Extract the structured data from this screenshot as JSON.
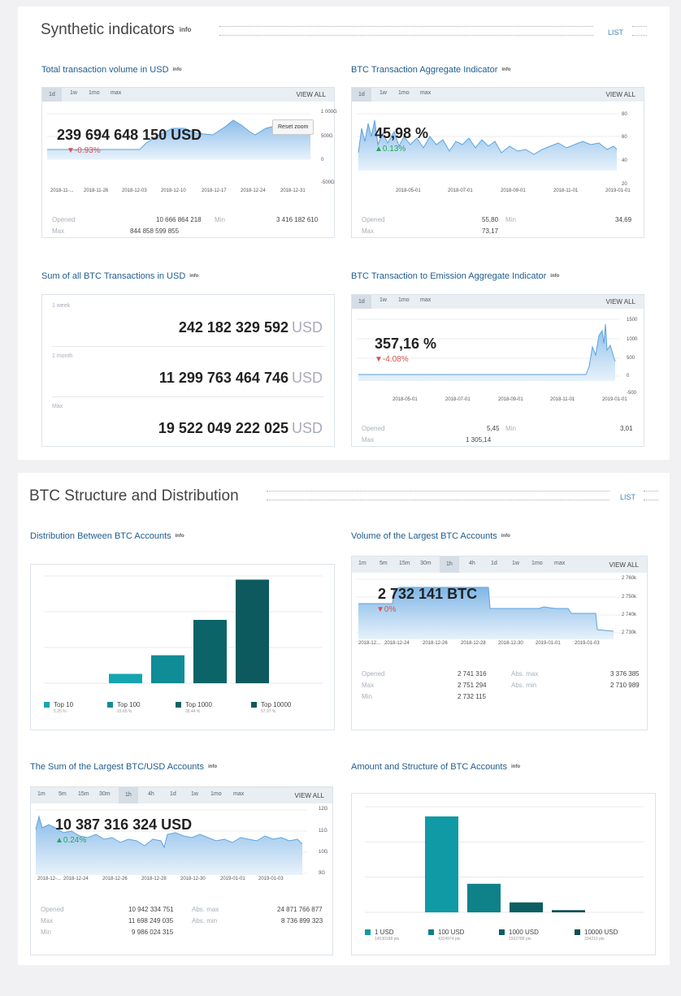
{
  "sec1": {
    "title": "Synthetic indicators",
    "info": "info",
    "list": "LIST",
    "tx_volume": {
      "title": "Total transaction volume in USD",
      "info": "info",
      "tabs": [
        "1d",
        "1w",
        "1mo",
        "max"
      ],
      "view_all": "VIEW ALL",
      "value": "239 694 648 150 USD",
      "change": "▼-0.93%",
      "reset_zoom": "Reset zoom",
      "x_ticks": [
        "2018-11-...",
        "2018-11-26",
        "2018-12-03",
        "2018-12-10",
        "2018-12-17",
        "2018-12-24",
        "2018-12-31"
      ],
      "y_ticks": [
        "1 000G",
        "500G",
        "0",
        "-500G"
      ],
      "opened_label": "Opened",
      "opened": "10 666 864 218",
      "min_label": "Min",
      "min": "3 416 182 610",
      "max_label": "Max",
      "max": "844 858 599 855"
    },
    "aggregate": {
      "title": "BTC Transaction Aggregate Indicator",
      "info": "info",
      "tabs": [
        "1d",
        "1w",
        "1mo",
        "max"
      ],
      "view_all": "VIEW ALL",
      "value": "45,98 %",
      "change": "▲0.13%",
      "x_ticks": [
        "2018-05-01",
        "2018-07-01",
        "2018-09-01",
        "2018-11-01",
        "2019-01-01"
      ],
      "y_ticks": [
        "80",
        "60",
        "40",
        "20"
      ],
      "opened_label": "Opened",
      "opened": "55,80",
      "min_label": "Min",
      "min": "34,69",
      "max_label": "Max",
      "max": "73,17"
    },
    "sum_all": {
      "title": "Sum of all BTC Transactions in USD",
      "info": "info",
      "rows": [
        {
          "label": "1 week",
          "value": "242 182 329 592",
          "unit": "USD"
        },
        {
          "label": "1 month",
          "value": "11 299 763 464 746",
          "unit": "USD"
        },
        {
          "label": "Max",
          "value": "19 522 049 222 025",
          "unit": "USD"
        }
      ]
    },
    "emission": {
      "title": "BTC Transaction to Emission Aggregate Indicator",
      "info": "info",
      "tabs": [
        "1d",
        "1w",
        "1mo",
        "max"
      ],
      "view_all": "VIEW ALL",
      "value": "357,16 %",
      "change": "▼-4.08%",
      "x_ticks": [
        "2018-05-01",
        "2018-07-01",
        "2018-09-01",
        "2018-11-01",
        "2019-01-01"
      ],
      "y_ticks": [
        "1500",
        "1000",
        "500",
        "0",
        "-500"
      ],
      "opened_label": "Opened",
      "opened": "5,45",
      "min_label": "Min",
      "min": "3,01",
      "max_label": "Max",
      "max": "1 305,14"
    }
  },
  "sec2": {
    "title": "BTC Structure and Distribution",
    "list": "LIST",
    "distribution": {
      "title": "Distribution Between BTC Accounts",
      "info": "info",
      "legend": [
        {
          "name": "Top 10",
          "sub": "5.25 %",
          "color": "#16a5b0"
        },
        {
          "name": "Top 100",
          "sub": "15.65 %",
          "color": "#0f8c96"
        },
        {
          "name": "Top 1000",
          "sub": "35.44 %",
          "color": "#0b6468"
        },
        {
          "name": "Top 10000",
          "sub": "57.97 %",
          "color": "#0d5a5e"
        }
      ]
    },
    "largest": {
      "title": "Volume of the Largest BTC Accounts",
      "info": "info",
      "tabs": [
        "1m",
        "5m",
        "15m",
        "30m",
        "1h",
        "4h",
        "1d",
        "1w",
        "1mo",
        "max"
      ],
      "active_tab": 4,
      "view_all": "VIEW ALL",
      "value": "2 732 141 BTC",
      "change": "▼0%",
      "x_ticks": [
        "2018-12...",
        "2018-12-24",
        "2018-12-26",
        "2018-12-28",
        "2018-12-30",
        "2019-01-01",
        "2019-01-03"
      ],
      "y_ticks": [
        "2 760k",
        "2 750k",
        "2 740k",
        "2 730k"
      ],
      "opened_label": "Opened",
      "opened": "2 741 316",
      "absmax_label": "Abs. max",
      "absmax": "3 376 385",
      "max_label": "Max",
      "max": "2 751 294",
      "absmin_label": "Abs. min",
      "absmin": "2 710 989",
      "min_label": "Min",
      "min": "2 732 115"
    },
    "sum_largest": {
      "title": "The Sum of the Largest BTC/USD Accounts",
      "info": "info",
      "tabs": [
        "1m",
        "5m",
        "15m",
        "30m",
        "1h",
        "4h",
        "1d",
        "1w",
        "1mo",
        "max"
      ],
      "active_tab": 4,
      "view_all": "VIEW ALL",
      "value": "10 387 316 324 USD",
      "change": "▲0.24%",
      "x_ticks": [
        "2018-12-...",
        "2018-12-24",
        "2018-12-26",
        "2018-12-28",
        "2018-12-30",
        "2019-01-01",
        "2019-01-03"
      ],
      "y_ticks": [
        "12G",
        "11G",
        "10G",
        "9G"
      ],
      "opened_label": "Opened",
      "opened": "10 942 334 751",
      "absmax_label": "Abs. max",
      "absmax": "24 871 766 877",
      "max_label": "Max",
      "max": "11 698 249 035",
      "absmin_label": "Abs. min",
      "absmin": "8 736 899 323",
      "min_label": "Min",
      "min": "9 986 024 315"
    },
    "amount": {
      "title": "Amount and Structure of BTC Accounts",
      "info": "info",
      "legend": [
        {
          "name": "1 USD",
          "sub": "14530188 pts",
          "color": "#0f9aa5"
        },
        {
          "name": "100 USD",
          "sub": "4324974 pts",
          "color": "#0f8189"
        },
        {
          "name": "1000 USD",
          "sub": "1502788 pts",
          "color": "#0b5f63"
        },
        {
          "name": "10000 USD",
          "sub": "334210 pts",
          "color": "#0d4f54"
        }
      ]
    }
  },
  "chart_data": [
    {
      "type": "bar",
      "categories": [
        "Top 10",
        "Top 100",
        "Top 1000",
        "Top 10000"
      ],
      "values": [
        5.25,
        15.65,
        35.44,
        57.97
      ],
      "ylim": [
        0,
        60
      ]
    },
    {
      "type": "bar",
      "categories": [
        "1 USD",
        "100 USD",
        "1000 USD",
        "10000 USD"
      ],
      "values": [
        14530188,
        4324974,
        1502788,
        334210
      ],
      "ylim": [
        0,
        16000000
      ]
    }
  ]
}
